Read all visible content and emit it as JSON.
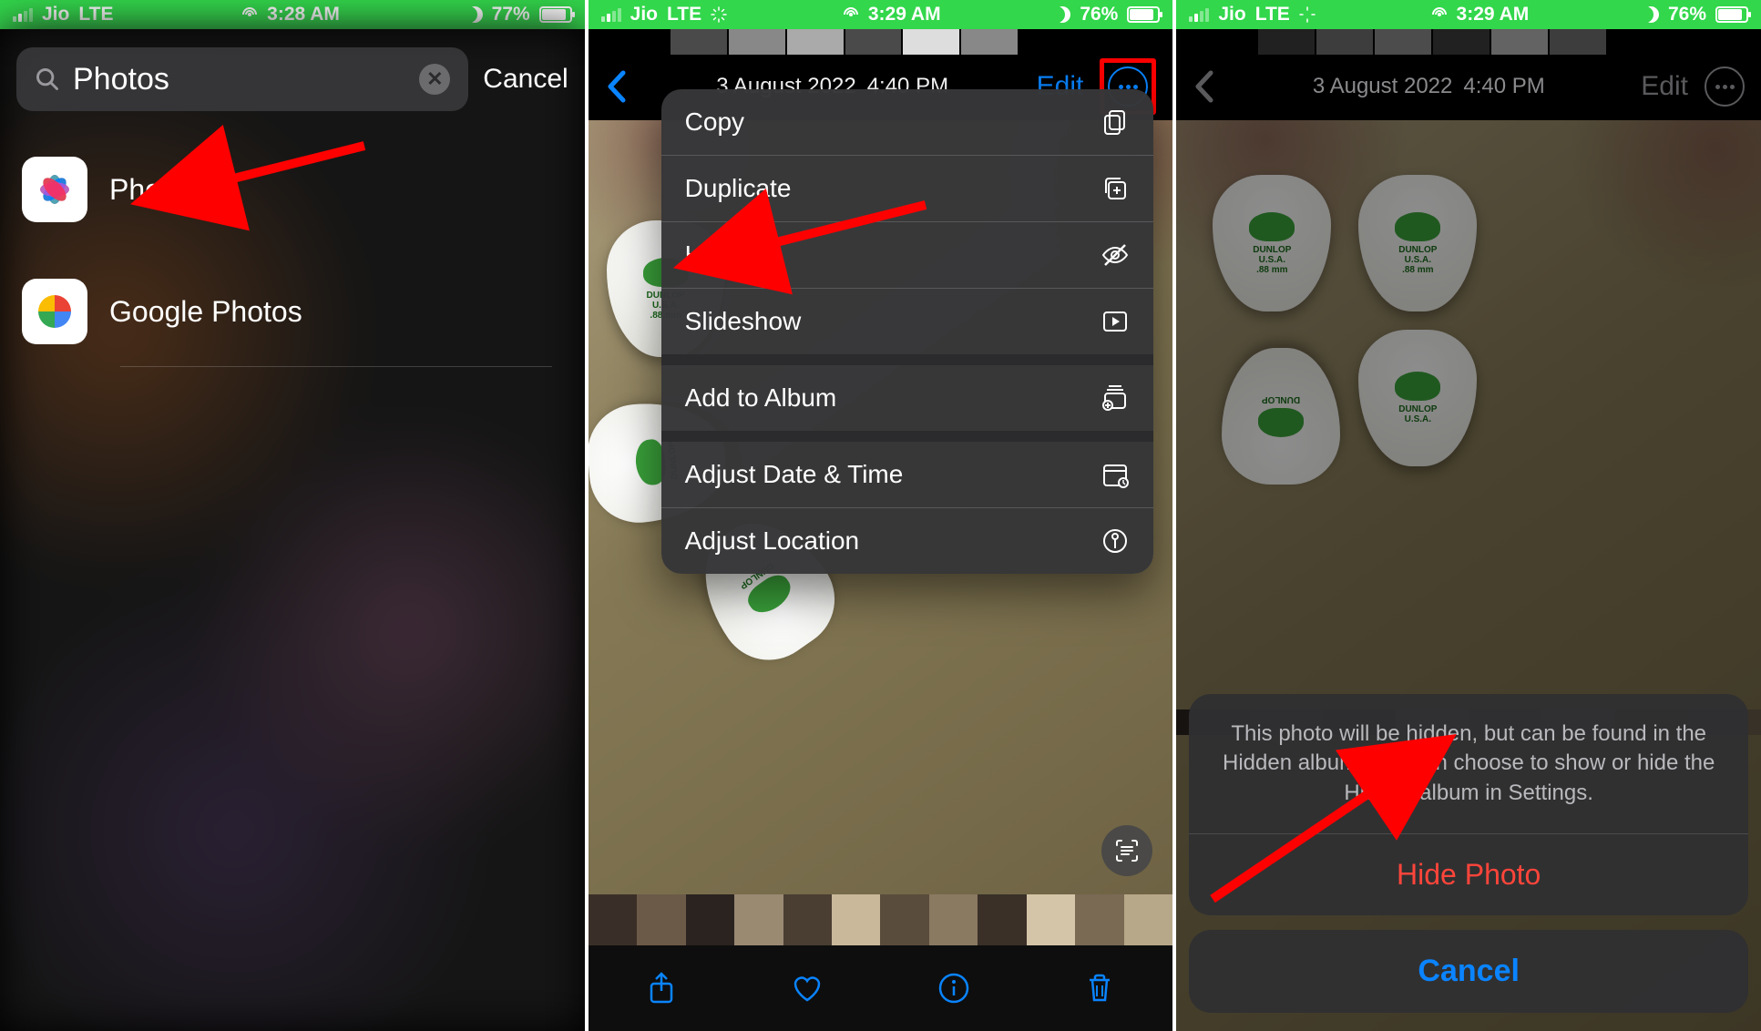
{
  "screen1": {
    "status": {
      "carrier": "Jio",
      "network": "LTE",
      "time": "3:28 AM",
      "battery": "77%"
    },
    "search": {
      "value": "Photos",
      "cancel": "Cancel"
    },
    "results": [
      {
        "name": "Photos"
      },
      {
        "name": "Google Photos"
      }
    ]
  },
  "screen2": {
    "status": {
      "carrier": "Jio",
      "network": "LTE",
      "time": "3:29 AM",
      "battery": "76%"
    },
    "header": {
      "date": "3 August 2022",
      "time": "4:40 PM",
      "edit": "Edit"
    },
    "menu": {
      "copy": "Copy",
      "duplicate": "Duplicate",
      "hide": "Hide",
      "slideshow": "Slideshow",
      "add_album": "Add to Album",
      "adjust_date": "Adjust Date & Time",
      "adjust_location": "Adjust Location"
    }
  },
  "screen3": {
    "status": {
      "carrier": "Jio",
      "network": "LTE",
      "time": "3:29 AM",
      "battery": "76%"
    },
    "header": {
      "date": "3 August 2022",
      "time": "4:40 PM",
      "edit": "Edit"
    },
    "sheet": {
      "message": "This photo will be hidden, but can be found in the Hidden album. You can choose to show or hide the Hidden album in Settings.",
      "hide": "Hide Photo",
      "cancel": "Cancel"
    }
  }
}
